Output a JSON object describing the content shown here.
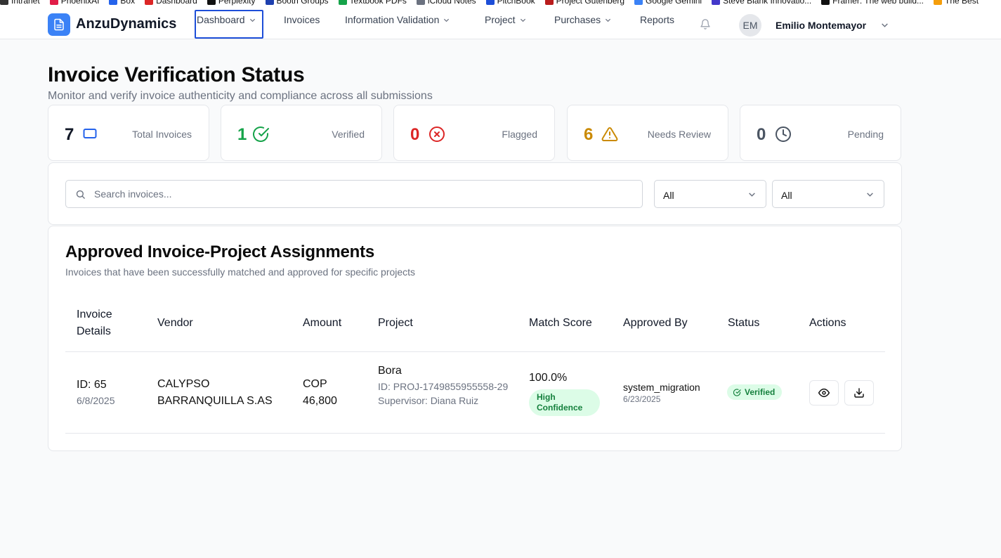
{
  "bookmarks": [
    "Intranet",
    "PhoenixAI",
    "Box",
    "Dashboard",
    "Perplexity",
    "Booth Groups",
    "Textbook PDFs",
    "iCloud Notes",
    "PitchBook",
    "Project Gutenberg",
    "Google Gemini",
    "Steve Blank Innovatio...",
    "Framer: The web build...",
    "The Best"
  ],
  "nav": {
    "brand": "AnzuDynamics",
    "items": [
      "Dashboard",
      "Invoices",
      "Information Validation",
      "Project",
      "Purchases",
      "Reports"
    ],
    "user_initials": "EM",
    "user_name": "Emilio Montemayor"
  },
  "page": {
    "title": "Invoice Verification Status",
    "subtitle": "Monitor and verify invoice authenticity and compliance across all submissions"
  },
  "stats": [
    {
      "value": "7",
      "label": "Total Invoices",
      "icon": "rectangle-icon",
      "color": "#111827",
      "icon_color": "#2563eb"
    },
    {
      "value": "1",
      "label": "Verified",
      "icon": "check-circle-icon",
      "color": "#16a34a",
      "icon_color": "#16a34a"
    },
    {
      "value": "0",
      "label": "Flagged",
      "icon": "x-circle-icon",
      "color": "#dc2626",
      "icon_color": "#dc2626"
    },
    {
      "value": "6",
      "label": "Needs Review",
      "icon": "warning-icon",
      "color": "#ca8a04",
      "icon_color": "#ca8a04"
    },
    {
      "value": "0",
      "label": "Pending",
      "icon": "clock-icon",
      "color": "#4b5563",
      "icon_color": "#4b5563"
    }
  ],
  "filters": {
    "search_placeholder": "Search invoices...",
    "select_1": "All",
    "select_2": "All"
  },
  "table": {
    "title": "Approved Invoice-Project Assignments",
    "subtitle": "Invoices that have been successfully matched and approved for specific projects",
    "headers": [
      "Invoice Details",
      "Vendor",
      "Amount",
      "Project",
      "Match Score",
      "Approved By",
      "Status",
      "Actions"
    ],
    "rows": [
      {
        "id": "ID: 65",
        "date": "6/8/2025",
        "vendor": "CALYPSO BARRANQUILLA S.AS",
        "amount": "COP 46,800",
        "project": "Bora",
        "project_id": "ID: PROJ-1749855955558-29",
        "supervisor": "Supervisor: Diana Ruiz",
        "score": "100.0%",
        "confidence": "High Confidence",
        "approved_by": "system_migration",
        "approved_date": "6/23/2025",
        "status": "Verified"
      }
    ]
  }
}
